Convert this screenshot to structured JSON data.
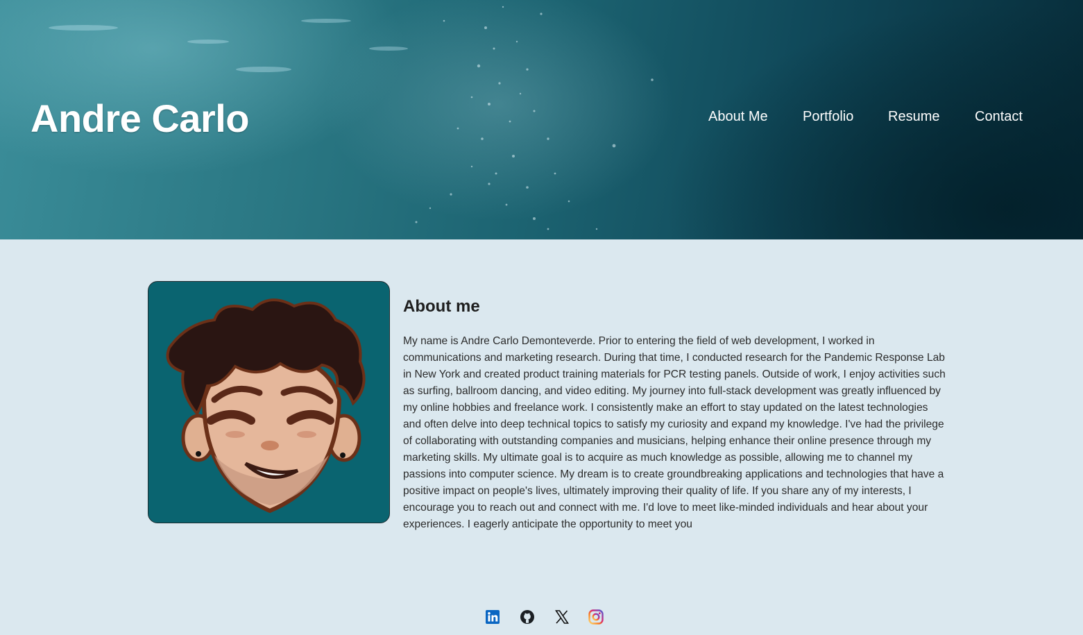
{
  "header": {
    "site_title": "Andre Carlo",
    "nav": [
      {
        "label": "About Me"
      },
      {
        "label": "Portfolio"
      },
      {
        "label": "Resume"
      },
      {
        "label": "Contact"
      }
    ]
  },
  "about": {
    "heading": "About me",
    "body": "My name is Andre Carlo Demonteverde. Prior to entering the field of web development, I worked in communications and marketing research. During that time, I conducted research for the Pandemic Response Lab in New York and created product training materials for PCR testing panels. Outside of work, I enjoy activities such as surfing, ballroom dancing, and video editing. My journey into full-stack development was greatly influenced by my online hobbies and freelance work. I consistently make an effort to stay updated on the latest technologies and often delve into deep technical topics to satisfy my curiosity and expand my knowledge. I've had the privilege of collaborating with outstanding companies and musicians, helping enhance their online presence through my marketing skills. My ultimate goal is to acquire as much knowledge as possible, allowing me to channel my passions into computer science. My dream is to create groundbreaking applications and technologies that have a positive impact on people's lives, ultimately improving their quality of life. If you share any of my interests, I encourage you to reach out and connect with me. I'd love to meet like-minded individuals and hear about your experiences. I eagerly anticipate the opportunity to meet you"
  },
  "socials": [
    {
      "icon": "linkedin-icon",
      "color": "#0a66c2"
    },
    {
      "icon": "github-icon",
      "color": "#1b1f23"
    },
    {
      "icon": "x-icon",
      "color": "#111111"
    },
    {
      "icon": "instagram-icon",
      "color": "#d62976"
    }
  ],
  "colors": {
    "page_background": "#dbe8ef",
    "avatar_background": "#0a6470",
    "header_text": "#ffffff"
  }
}
